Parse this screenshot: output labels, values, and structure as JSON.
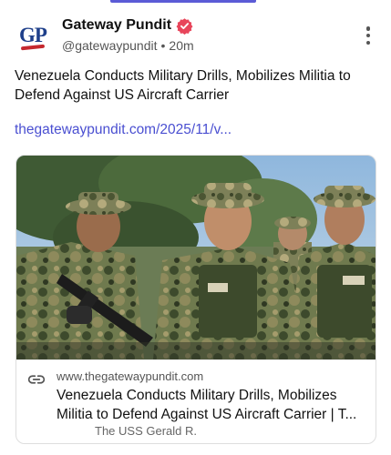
{
  "post": {
    "author_name": "Gateway Pundit",
    "author_handle": "@gatewaypundit",
    "separator": "•",
    "time_ago": "20m",
    "text": "Venezuela Conducts Military Drills, Mobilizes Militia to Defend Against US Aircraft Carrier",
    "link_text": "thegatewaypundit.com/2025/11/v..."
  },
  "avatar": {
    "logo_text": "GP"
  },
  "card": {
    "domain": "www.thegatewaypundit.com",
    "title": "Venezuela Conducts Military Drills, Mobilizes Militia to Defend Against US Aircraft Carrier | T...",
    "description": "The USS Gerald R.",
    "image_alt": "Soldiers in camouflage uniforms and helmets during military drills"
  },
  "colors": {
    "accent": "#5b5bd6",
    "link": "#4a4fd1",
    "verified_badge": "#e8455b",
    "logo_blue": "#1e3f8a",
    "logo_red": "#c5282e"
  },
  "icons": {
    "verified": "verified-badge-icon",
    "more": "more-vertical-icon",
    "link": "link-chain-icon"
  }
}
